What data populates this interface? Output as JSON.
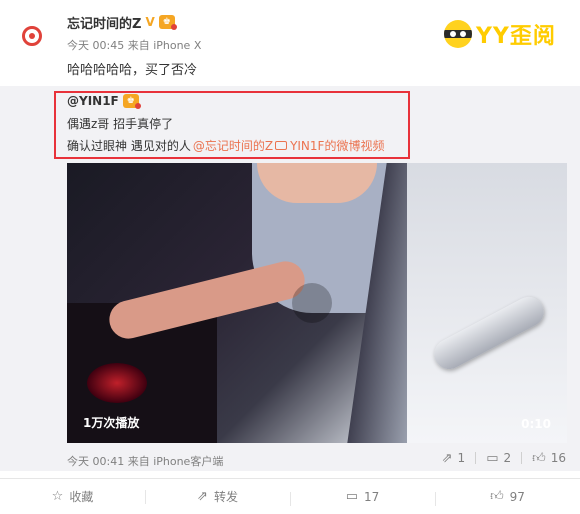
{
  "post": {
    "author": "忘记时间的Z",
    "verified_mark": "V",
    "meta": "今天 00:45 来自 iPhone X",
    "text": "哈哈哈哈哈，买了否冷"
  },
  "logo": {
    "text": "YY歪阅",
    "accent_color": "#ffcc00"
  },
  "repost": {
    "author": "@YIN1F",
    "line1": "偶遇z哥 招手真停了",
    "line2_text": "确认过眼神 遇见对的人",
    "mention": "@忘记时间的Z",
    "video_link": "YIN1F的微博视频",
    "highlight_color": "#e8323a",
    "video": {
      "views": "1万次播放",
      "duration": "0:10"
    },
    "meta": "今天 00:41 来自 iPhone客户端",
    "actions": {
      "repost_count": "1",
      "comment_count": "2",
      "like_count": "16"
    }
  },
  "toolbar": {
    "favorite_label": "收藏",
    "repost_label": "转发",
    "comment_count": "17",
    "like_count": "97"
  },
  "icons": {
    "favorite": "star-icon",
    "repost": "repost-icon",
    "comment": "comment-icon",
    "like": "thumbs-up-icon"
  }
}
